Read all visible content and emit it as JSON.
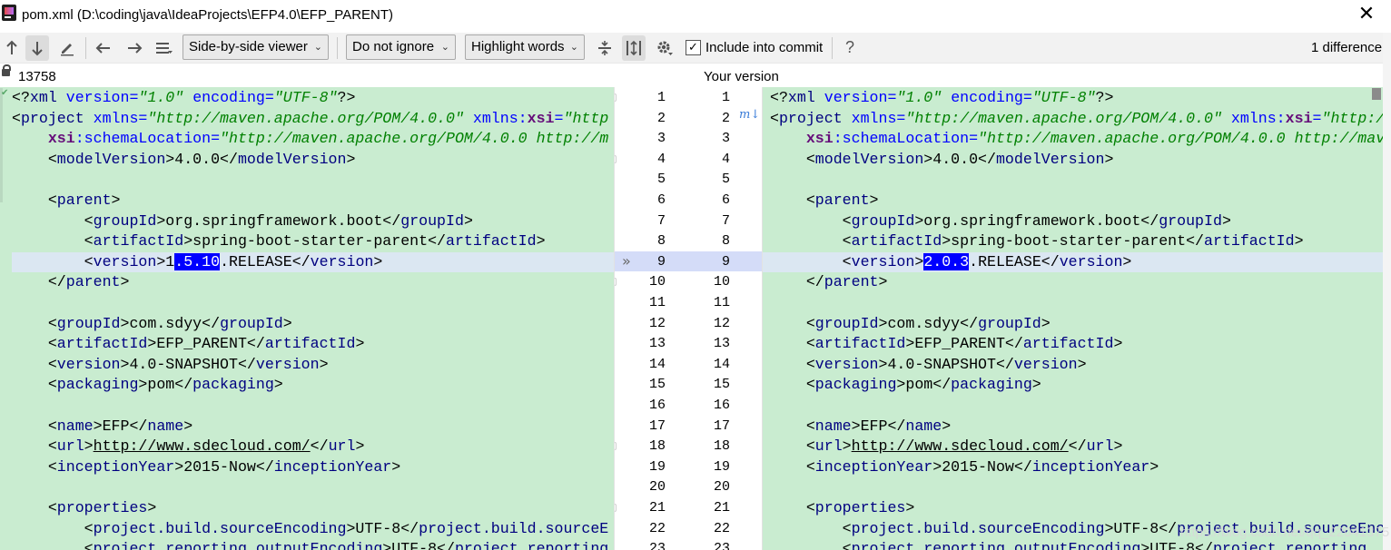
{
  "window": {
    "title": "pom.xml (D:\\coding\\java\\IdeaProjects\\EFP4.0\\EFP_PARENT)",
    "close_glyph": "✕"
  },
  "toolbar": {
    "prev_icon": "up-arrow-icon",
    "next_icon": "down-arrow-icon",
    "edit_icon": "pencil-icon",
    "back_icon": "left-arrow-icon",
    "forward_icon": "right-arrow-icon",
    "menu_icon": "hamburger-icon",
    "viewer_label": "Side-by-side viewer",
    "ignore_label": "Do not ignore",
    "highlight_label": "Highlight words",
    "include_label": "Include into commit",
    "include_checked": true,
    "help_label": "?",
    "difference_count": "1 difference"
  },
  "header": {
    "left_revision": "13758",
    "right_label": "Your version"
  },
  "colors": {
    "pane_bg": "#c9ecd0",
    "changed_line_bg": "#dbe7f2",
    "selection_bg": "#0000ff",
    "gutter_highlight": "#d4dcf8"
  },
  "left_lines": [
    {
      "n": "1",
      "segs": [
        [
          "pi",
          "<?"
        ],
        [
          "name",
          "xml "
        ],
        [
          "attr",
          "version="
        ],
        [
          "str",
          "\"1.0\""
        ],
        [
          "attr",
          " encoding="
        ],
        [
          "str",
          "\"UTF-8\""
        ],
        [
          "pi",
          "?>"
        ]
      ]
    },
    {
      "n": "2",
      "segs": [
        [
          "tag",
          "<"
        ],
        [
          "name",
          "project "
        ],
        [
          "attr",
          "xmlns="
        ],
        [
          "str",
          "\"http://maven.apache.org/POM/4.0.0\""
        ],
        [
          "attr",
          " xmlns:"
        ],
        [
          "ns",
          "xsi"
        ],
        [
          "attr",
          "="
        ],
        [
          "str",
          "\"http"
        ]
      ]
    },
    {
      "n": "3",
      "segs": [
        [
          "pi",
          "    "
        ],
        [
          "ns",
          "xsi"
        ],
        [
          "attr",
          ":schemaLocation="
        ],
        [
          "str",
          "\"http://maven.apache.org/POM/4.0.0 http://m"
        ]
      ]
    },
    {
      "n": "4",
      "segs": [
        [
          "pi",
          "    <"
        ],
        [
          "name",
          "modelVersion"
        ],
        [
          "tag",
          ">4.0.0</"
        ],
        [
          "name",
          "modelVersion"
        ],
        [
          "tag",
          ">"
        ]
      ]
    },
    {
      "n": "5",
      "segs": []
    },
    {
      "n": "6",
      "segs": [
        [
          "pi",
          "    <"
        ],
        [
          "name",
          "parent"
        ],
        [
          "tag",
          ">"
        ]
      ]
    },
    {
      "n": "7",
      "segs": [
        [
          "pi",
          "        <"
        ],
        [
          "name",
          "groupId"
        ],
        [
          "tag",
          ">org.springframework.boot</"
        ],
        [
          "name",
          "groupId"
        ],
        [
          "tag",
          ">"
        ]
      ]
    },
    {
      "n": "8",
      "segs": [
        [
          "pi",
          "        <"
        ],
        [
          "name",
          "artifactId"
        ],
        [
          "tag",
          ">spring-boot-starter-parent</"
        ],
        [
          "name",
          "artifactId"
        ],
        [
          "tag",
          ">"
        ]
      ]
    },
    {
      "n": "9",
      "segs": [
        [
          "pi",
          "        <"
        ],
        [
          "name",
          "version"
        ],
        [
          "tag",
          ">1"
        ],
        [
          "sel",
          ".5.10"
        ],
        [
          "tag",
          ".RELEASE</"
        ],
        [
          "name",
          "version"
        ],
        [
          "tag",
          ">"
        ]
      ],
      "changed": true
    },
    {
      "n": "10",
      "segs": [
        [
          "pi",
          "    </"
        ],
        [
          "name",
          "parent"
        ],
        [
          "tag",
          ">"
        ]
      ]
    },
    {
      "n": "11",
      "segs": []
    },
    {
      "n": "12",
      "segs": [
        [
          "pi",
          "    <"
        ],
        [
          "name",
          "groupId"
        ],
        [
          "tag",
          ">com.sdyy</"
        ],
        [
          "name",
          "groupId"
        ],
        [
          "tag",
          ">"
        ]
      ]
    },
    {
      "n": "13",
      "segs": [
        [
          "pi",
          "    <"
        ],
        [
          "name",
          "artifactId"
        ],
        [
          "tag",
          ">EFP_PARENT</"
        ],
        [
          "name",
          "artifactId"
        ],
        [
          "tag",
          ">"
        ]
      ]
    },
    {
      "n": "14",
      "segs": [
        [
          "pi",
          "    <"
        ],
        [
          "name",
          "version"
        ],
        [
          "tag",
          ">4.0-SNAPSHOT</"
        ],
        [
          "name",
          "version"
        ],
        [
          "tag",
          ">"
        ]
      ]
    },
    {
      "n": "15",
      "segs": [
        [
          "pi",
          "    <"
        ],
        [
          "name",
          "packaging"
        ],
        [
          "tag",
          ">pom</"
        ],
        [
          "name",
          "packaging"
        ],
        [
          "tag",
          ">"
        ]
      ]
    },
    {
      "n": "16",
      "segs": []
    },
    {
      "n": "17",
      "segs": [
        [
          "pi",
          "    <"
        ],
        [
          "name",
          "name"
        ],
        [
          "tag",
          ">EFP</"
        ],
        [
          "name",
          "name"
        ],
        [
          "tag",
          ">"
        ]
      ]
    },
    {
      "n": "18",
      "segs": [
        [
          "pi",
          "    <"
        ],
        [
          "name",
          "url"
        ],
        [
          "tag",
          ">"
        ],
        [
          "url",
          "http://www.sdecloud.com/"
        ],
        [
          "tag",
          "</"
        ],
        [
          "name",
          "url"
        ],
        [
          "tag",
          ">"
        ]
      ]
    },
    {
      "n": "19",
      "segs": [
        [
          "pi",
          "    <"
        ],
        [
          "name",
          "inceptionYear"
        ],
        [
          "tag",
          ">2015-Now</"
        ],
        [
          "name",
          "inceptionYear"
        ],
        [
          "tag",
          ">"
        ]
      ]
    },
    {
      "n": "20",
      "segs": []
    },
    {
      "n": "21",
      "segs": [
        [
          "pi",
          "    <"
        ],
        [
          "name",
          "properties"
        ],
        [
          "tag",
          ">"
        ]
      ]
    },
    {
      "n": "22",
      "segs": [
        [
          "pi",
          "        <"
        ],
        [
          "name",
          "project.build.sourceEncoding"
        ],
        [
          "tag",
          ">UTF-8</"
        ],
        [
          "name",
          "project.build.sourceE"
        ]
      ]
    },
    {
      "n": "23",
      "segs": [
        [
          "pi",
          "        <"
        ],
        [
          "name",
          "project.reporting.outputEncoding"
        ],
        [
          "tag",
          ">UTF-8</"
        ],
        [
          "name",
          "project.reporting"
        ]
      ]
    }
  ],
  "right_lines": [
    {
      "n": "1",
      "segs": [
        [
          "pi",
          "<?"
        ],
        [
          "name",
          "xml "
        ],
        [
          "attr",
          "version="
        ],
        [
          "str",
          "\"1.0\""
        ],
        [
          "attr",
          " encoding="
        ],
        [
          "str",
          "\"UTF-8\""
        ],
        [
          "pi",
          "?>"
        ]
      ]
    },
    {
      "n": "2",
      "segs": [
        [
          "tag",
          "<"
        ],
        [
          "name",
          "project "
        ],
        [
          "attr",
          "xmlns="
        ],
        [
          "str",
          "\"http://maven.apache.org/POM/4.0.0\""
        ],
        [
          "attr",
          " xmlns:"
        ],
        [
          "ns",
          "xsi"
        ],
        [
          "attr",
          "="
        ],
        [
          "str",
          "\"http:/"
        ]
      ]
    },
    {
      "n": "3",
      "segs": [
        [
          "pi",
          "    "
        ],
        [
          "ns",
          "xsi"
        ],
        [
          "attr",
          ":schemaLocation="
        ],
        [
          "str",
          "\"http://maven.apache.org/POM/4.0.0 http://mave"
        ]
      ]
    },
    {
      "n": "4",
      "segs": [
        [
          "pi",
          "    <"
        ],
        [
          "name",
          "modelVersion"
        ],
        [
          "tag",
          ">4.0.0</"
        ],
        [
          "name",
          "modelVersion"
        ],
        [
          "tag",
          ">"
        ]
      ]
    },
    {
      "n": "5",
      "segs": []
    },
    {
      "n": "6",
      "segs": [
        [
          "pi",
          "    <"
        ],
        [
          "name",
          "parent"
        ],
        [
          "tag",
          ">"
        ]
      ]
    },
    {
      "n": "7",
      "segs": [
        [
          "pi",
          "        <"
        ],
        [
          "name",
          "groupId"
        ],
        [
          "tag",
          ">org.springframework.boot</"
        ],
        [
          "name",
          "groupId"
        ],
        [
          "tag",
          ">"
        ]
      ]
    },
    {
      "n": "8",
      "segs": [
        [
          "pi",
          "        <"
        ],
        [
          "name",
          "artifactId"
        ],
        [
          "tag",
          ">spring-boot-starter-parent</"
        ],
        [
          "name",
          "artifactId"
        ],
        [
          "tag",
          ">"
        ]
      ]
    },
    {
      "n": "9",
      "segs": [
        [
          "pi",
          "        <"
        ],
        [
          "name",
          "version"
        ],
        [
          "tag",
          ">"
        ],
        [
          "sel",
          "2.0.3"
        ],
        [
          "tag",
          ".RELEASE</"
        ],
        [
          "name",
          "version"
        ],
        [
          "tag",
          ">"
        ]
      ],
      "changed": true
    },
    {
      "n": "10",
      "segs": [
        [
          "pi",
          "    </"
        ],
        [
          "name",
          "parent"
        ],
        [
          "tag",
          ">"
        ]
      ]
    },
    {
      "n": "11",
      "segs": []
    },
    {
      "n": "12",
      "segs": [
        [
          "pi",
          "    <"
        ],
        [
          "name",
          "groupId"
        ],
        [
          "tag",
          ">com.sdyy</"
        ],
        [
          "name",
          "groupId"
        ],
        [
          "tag",
          ">"
        ]
      ]
    },
    {
      "n": "13",
      "segs": [
        [
          "pi",
          "    <"
        ],
        [
          "name",
          "artifactId"
        ],
        [
          "tag",
          ">EFP_PARENT</"
        ],
        [
          "name",
          "artifactId"
        ],
        [
          "tag",
          ">"
        ]
      ]
    },
    {
      "n": "14",
      "segs": [
        [
          "pi",
          "    <"
        ],
        [
          "name",
          "version"
        ],
        [
          "tag",
          ">4.0-SNAPSHOT</"
        ],
        [
          "name",
          "version"
        ],
        [
          "tag",
          ">"
        ]
      ]
    },
    {
      "n": "15",
      "segs": [
        [
          "pi",
          "    <"
        ],
        [
          "name",
          "packaging"
        ],
        [
          "tag",
          ">pom</"
        ],
        [
          "name",
          "packaging"
        ],
        [
          "tag",
          ">"
        ]
      ]
    },
    {
      "n": "16",
      "segs": []
    },
    {
      "n": "17",
      "segs": [
        [
          "pi",
          "    <"
        ],
        [
          "name",
          "name"
        ],
        [
          "tag",
          ">EFP</"
        ],
        [
          "name",
          "name"
        ],
        [
          "tag",
          ">"
        ]
      ]
    },
    {
      "n": "18",
      "segs": [
        [
          "pi",
          "    <"
        ],
        [
          "name",
          "url"
        ],
        [
          "tag",
          ">"
        ],
        [
          "url",
          "http://www.sdecloud.com/"
        ],
        [
          "tag",
          "</"
        ],
        [
          "name",
          "url"
        ],
        [
          "tag",
          ">"
        ]
      ]
    },
    {
      "n": "19",
      "segs": [
        [
          "pi",
          "    <"
        ],
        [
          "name",
          "inceptionYear"
        ],
        [
          "tag",
          ">2015-Now</"
        ],
        [
          "name",
          "inceptionYear"
        ],
        [
          "tag",
          ">"
        ]
      ]
    },
    {
      "n": "20",
      "segs": []
    },
    {
      "n": "21",
      "segs": [
        [
          "pi",
          "    <"
        ],
        [
          "name",
          "properties"
        ],
        [
          "tag",
          ">"
        ]
      ]
    },
    {
      "n": "22",
      "segs": [
        [
          "pi",
          "        <"
        ],
        [
          "name",
          "project.build.sourceEncoding"
        ],
        [
          "tag",
          ">UTF-8</"
        ],
        [
          "name",
          "project.build.sourceEnc"
        ]
      ]
    },
    {
      "n": "23",
      "segs": [
        [
          "pi",
          "        <"
        ],
        [
          "name",
          "project.reporting.outputEncoding"
        ],
        [
          "tag",
          ">UTF-8</"
        ],
        [
          "name",
          "project.reporting"
        ]
      ]
    }
  ],
  "watermark": "https://blog.csdn.net/qq_22041375"
}
